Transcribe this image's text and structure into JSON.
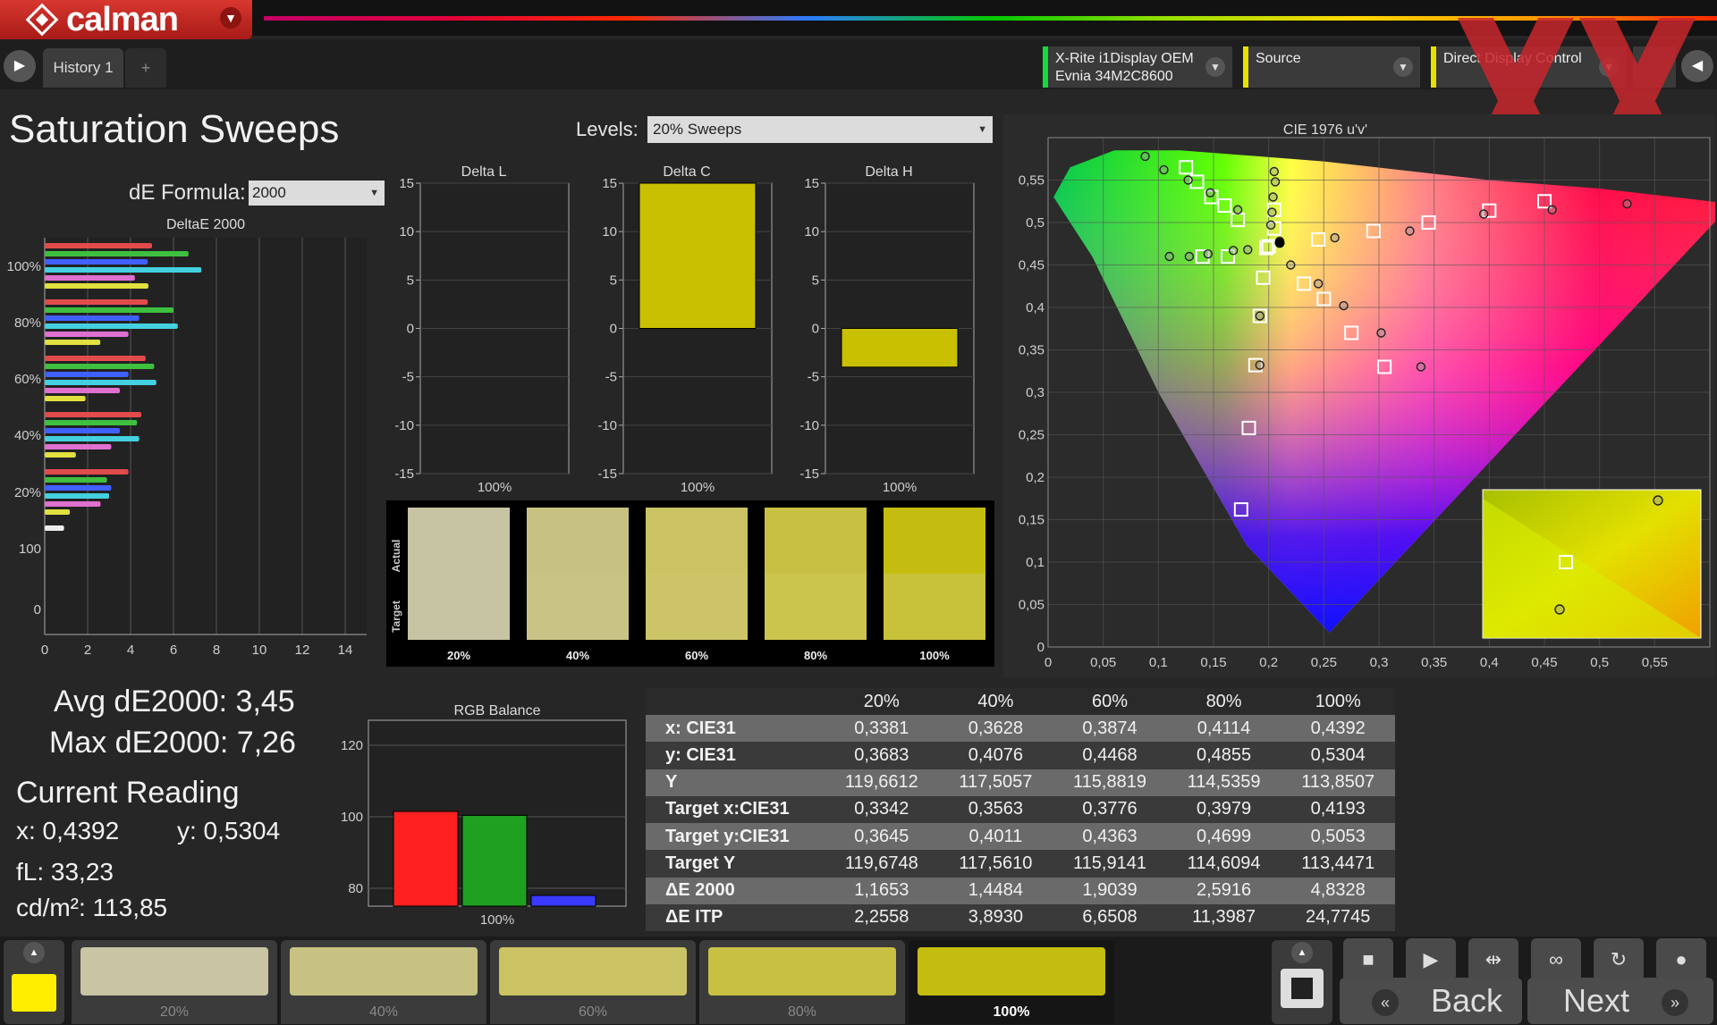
{
  "app": {
    "logo_text": "calman"
  },
  "tabs": [
    {
      "label": "History 1"
    },
    {
      "label": "+"
    }
  ],
  "devices": [
    {
      "line1": "X-Rite i1Display OEM",
      "line2": "Evnia 34M2C8600",
      "accent": "#16d93a"
    },
    {
      "line1": "Source",
      "line2": "",
      "accent": "#e8e000"
    },
    {
      "line1": "Direct Display Control",
      "line2": "",
      "accent": "#e8e000"
    }
  ],
  "page_title": "Saturation Sweeps",
  "levels": {
    "label": "Levels:",
    "value": "20% Sweeps"
  },
  "de_formula": {
    "label": "dE Formula:",
    "value": "2000"
  },
  "deltae_chart": {
    "title": "DeltaE 2000",
    "x_ticks": [
      "0",
      "2",
      "4",
      "6",
      "8",
      "10",
      "12",
      "14"
    ],
    "y_labels": [
      "100%",
      "80%",
      "60%",
      "40%",
      "20%",
      "100",
      "0"
    ],
    "xlim": [
      0,
      15
    ],
    "groups": [
      {
        "label": "100%",
        "values": [
          5.0,
          6.7,
          4.8,
          7.3,
          4.2,
          4.83
        ]
      },
      {
        "label": "80%",
        "values": [
          4.8,
          6.0,
          4.4,
          6.2,
          3.9,
          2.59
        ]
      },
      {
        "label": "60%",
        "values": [
          4.7,
          5.1,
          3.9,
          5.2,
          3.5,
          1.9
        ]
      },
      {
        "label": "40%",
        "values": [
          4.5,
          4.3,
          3.5,
          4.4,
          3.1,
          1.45
        ]
      },
      {
        "label": "20%",
        "values": [
          3.9,
          2.9,
          3.1,
          3.0,
          2.6,
          1.17
        ]
      },
      {
        "label": "100",
        "values": [
          0.9
        ]
      }
    ],
    "colors": [
      "#e24b4b",
      "#3fbf3f",
      "#4060ff",
      "#44d0e0",
      "#e070d0",
      "#e0e040"
    ]
  },
  "delta_charts": [
    {
      "title": "Delta L",
      "value": 0.0,
      "category": "100%"
    },
    {
      "title": "Delta C",
      "value": 15.0,
      "category": "100%"
    },
    {
      "title": "Delta H",
      "value": -4.0,
      "category": "100%"
    }
  ],
  "delta_ticks": [
    "15",
    "10",
    "5",
    "0",
    "-5",
    "-10",
    "-15"
  ],
  "swatches": {
    "actual_label": "Actual",
    "target_label": "Target",
    "items": [
      {
        "label": "20%",
        "actual": "#c7c4a3",
        "target": "#c7c4a3"
      },
      {
        "label": "40%",
        "actual": "#c8c282",
        "target": "#c8c485"
      },
      {
        "label": "60%",
        "actual": "#cbc363",
        "target": "#ccc467"
      },
      {
        "label": "80%",
        "actual": "#c8c043",
        "target": "#cbc44d"
      },
      {
        "label": "100%",
        "actual": "#c4bd10",
        "target": "#c8c23a"
      }
    ]
  },
  "cie": {
    "title": "CIE 1976 u'v'",
    "x_ticks": [
      "0",
      "0,05",
      "0,1",
      "0,15",
      "0,2",
      "0,25",
      "0,3",
      "0,35",
      "0,4",
      "0,45",
      "0,5",
      "0,55"
    ],
    "y_ticks": [
      "0",
      "0,05",
      "0,1",
      "0,15",
      "0,2",
      "0,25",
      "0,3",
      "0,35",
      "0,4",
      "0,45",
      "0,5",
      "0,55"
    ],
    "xlim": [
      0,
      0.6
    ],
    "ylim": [
      0,
      0.6
    ],
    "targets": [
      [
        0.125,
        0.565
      ],
      [
        0.135,
        0.548
      ],
      [
        0.148,
        0.53
      ],
      [
        0.16,
        0.52
      ],
      [
        0.172,
        0.503
      ],
      [
        0.205,
        0.515
      ],
      [
        0.205,
        0.493
      ],
      [
        0.2,
        0.472
      ],
      [
        0.198,
        0.47
      ],
      [
        0.245,
        0.48
      ],
      [
        0.295,
        0.49
      ],
      [
        0.345,
        0.5
      ],
      [
        0.4,
        0.514
      ],
      [
        0.45,
        0.525
      ],
      [
        0.14,
        0.46
      ],
      [
        0.163,
        0.46
      ],
      [
        0.195,
        0.435
      ],
      [
        0.232,
        0.428
      ],
      [
        0.25,
        0.41
      ],
      [
        0.275,
        0.37
      ],
      [
        0.305,
        0.33
      ],
      [
        0.192,
        0.39
      ],
      [
        0.188,
        0.332
      ],
      [
        0.182,
        0.258
      ],
      [
        0.175,
        0.162
      ]
    ],
    "actual": [
      [
        0.088,
        0.578
      ],
      [
        0.105,
        0.562
      ],
      [
        0.127,
        0.55
      ],
      [
        0.147,
        0.535
      ],
      [
        0.172,
        0.515
      ],
      [
        0.205,
        0.56
      ],
      [
        0.206,
        0.548
      ],
      [
        0.204,
        0.53
      ],
      [
        0.203,
        0.512
      ],
      [
        0.202,
        0.497
      ],
      [
        0.21,
        0.478
      ],
      [
        0.26,
        0.482
      ],
      [
        0.328,
        0.49
      ],
      [
        0.395,
        0.51
      ],
      [
        0.457,
        0.515
      ],
      [
        0.525,
        0.522
      ],
      [
        0.11,
        0.46
      ],
      [
        0.128,
        0.46
      ],
      [
        0.145,
        0.463
      ],
      [
        0.168,
        0.467
      ],
      [
        0.181,
        0.468
      ],
      [
        0.22,
        0.45
      ],
      [
        0.245,
        0.428
      ],
      [
        0.268,
        0.402
      ],
      [
        0.302,
        0.37
      ],
      [
        0.338,
        0.33
      ],
      [
        0.192,
        0.39
      ],
      [
        0.192,
        0.332
      ]
    ],
    "current": [
      0.21,
      0.476
    ]
  },
  "stats": {
    "avg": "Avg dE2000: 3,45",
    "max": "Max dE2000: 7,26"
  },
  "current_reading": {
    "title": "Current Reading",
    "x": "x: 0,4392",
    "y": "y: 0,5304",
    "fl": "fL: 33,23",
    "cdm2": "cd/m²: 113,85"
  },
  "rgb_balance": {
    "title": "RGB Balance",
    "category": "100%",
    "y_ticks": [
      "120",
      "100",
      "80"
    ],
    "ylim": [
      75,
      127
    ],
    "values": [
      {
        "name": "R",
        "value": 101.5,
        "color": "#ff2020"
      },
      {
        "name": "G",
        "value": 100.4,
        "color": "#20a020"
      },
      {
        "name": "B",
        "value": 78.0,
        "color": "#3a3aff"
      }
    ]
  },
  "table": {
    "columns": [
      "20%",
      "40%",
      "60%",
      "80%",
      "100%"
    ],
    "rows": [
      {
        "label": "x: CIE31",
        "values": [
          "0,3381",
          "0,3628",
          "0,3874",
          "0,4114",
          "0,4392"
        ]
      },
      {
        "label": "y: CIE31",
        "values": [
          "0,3683",
          "0,4076",
          "0,4468",
          "0,4855",
          "0,5304"
        ]
      },
      {
        "label": "Y",
        "values": [
          "119,6612",
          "117,5057",
          "115,8819",
          "114,5359",
          "113,8507"
        ]
      },
      {
        "label": "Target x:CIE31",
        "values": [
          "0,3342",
          "0,3563",
          "0,3776",
          "0,3979",
          "0,4193"
        ]
      },
      {
        "label": "Target y:CIE31",
        "values": [
          "0,3645",
          "0,4011",
          "0,4363",
          "0,4699",
          "0,5053"
        ]
      },
      {
        "label": "Target Y",
        "values": [
          "119,6748",
          "117,5610",
          "115,9141",
          "114,6094",
          "113,4471"
        ]
      },
      {
        "label": "ΔE 2000",
        "values": [
          "1,1653",
          "1,4484",
          "1,9039",
          "2,5916",
          "4,8328"
        ]
      },
      {
        "label": "ΔE ITP",
        "values": [
          "2,2558",
          "3,8930",
          "6,6508",
          "11,3987",
          "24,7745"
        ]
      }
    ]
  },
  "bottom_swatches": [
    {
      "label": "20%",
      "color": "#c8c4a4",
      "selected": false
    },
    {
      "label": "40%",
      "color": "#c8c282",
      "selected": false
    },
    {
      "label": "60%",
      "color": "#cbc363",
      "selected": false
    },
    {
      "label": "80%",
      "color": "#c8c043",
      "selected": false
    },
    {
      "label": "100%",
      "color": "#c4bd10",
      "selected": true
    }
  ],
  "current_color": "#ffee00",
  "nav": {
    "back": "Back",
    "next": "Next"
  }
}
